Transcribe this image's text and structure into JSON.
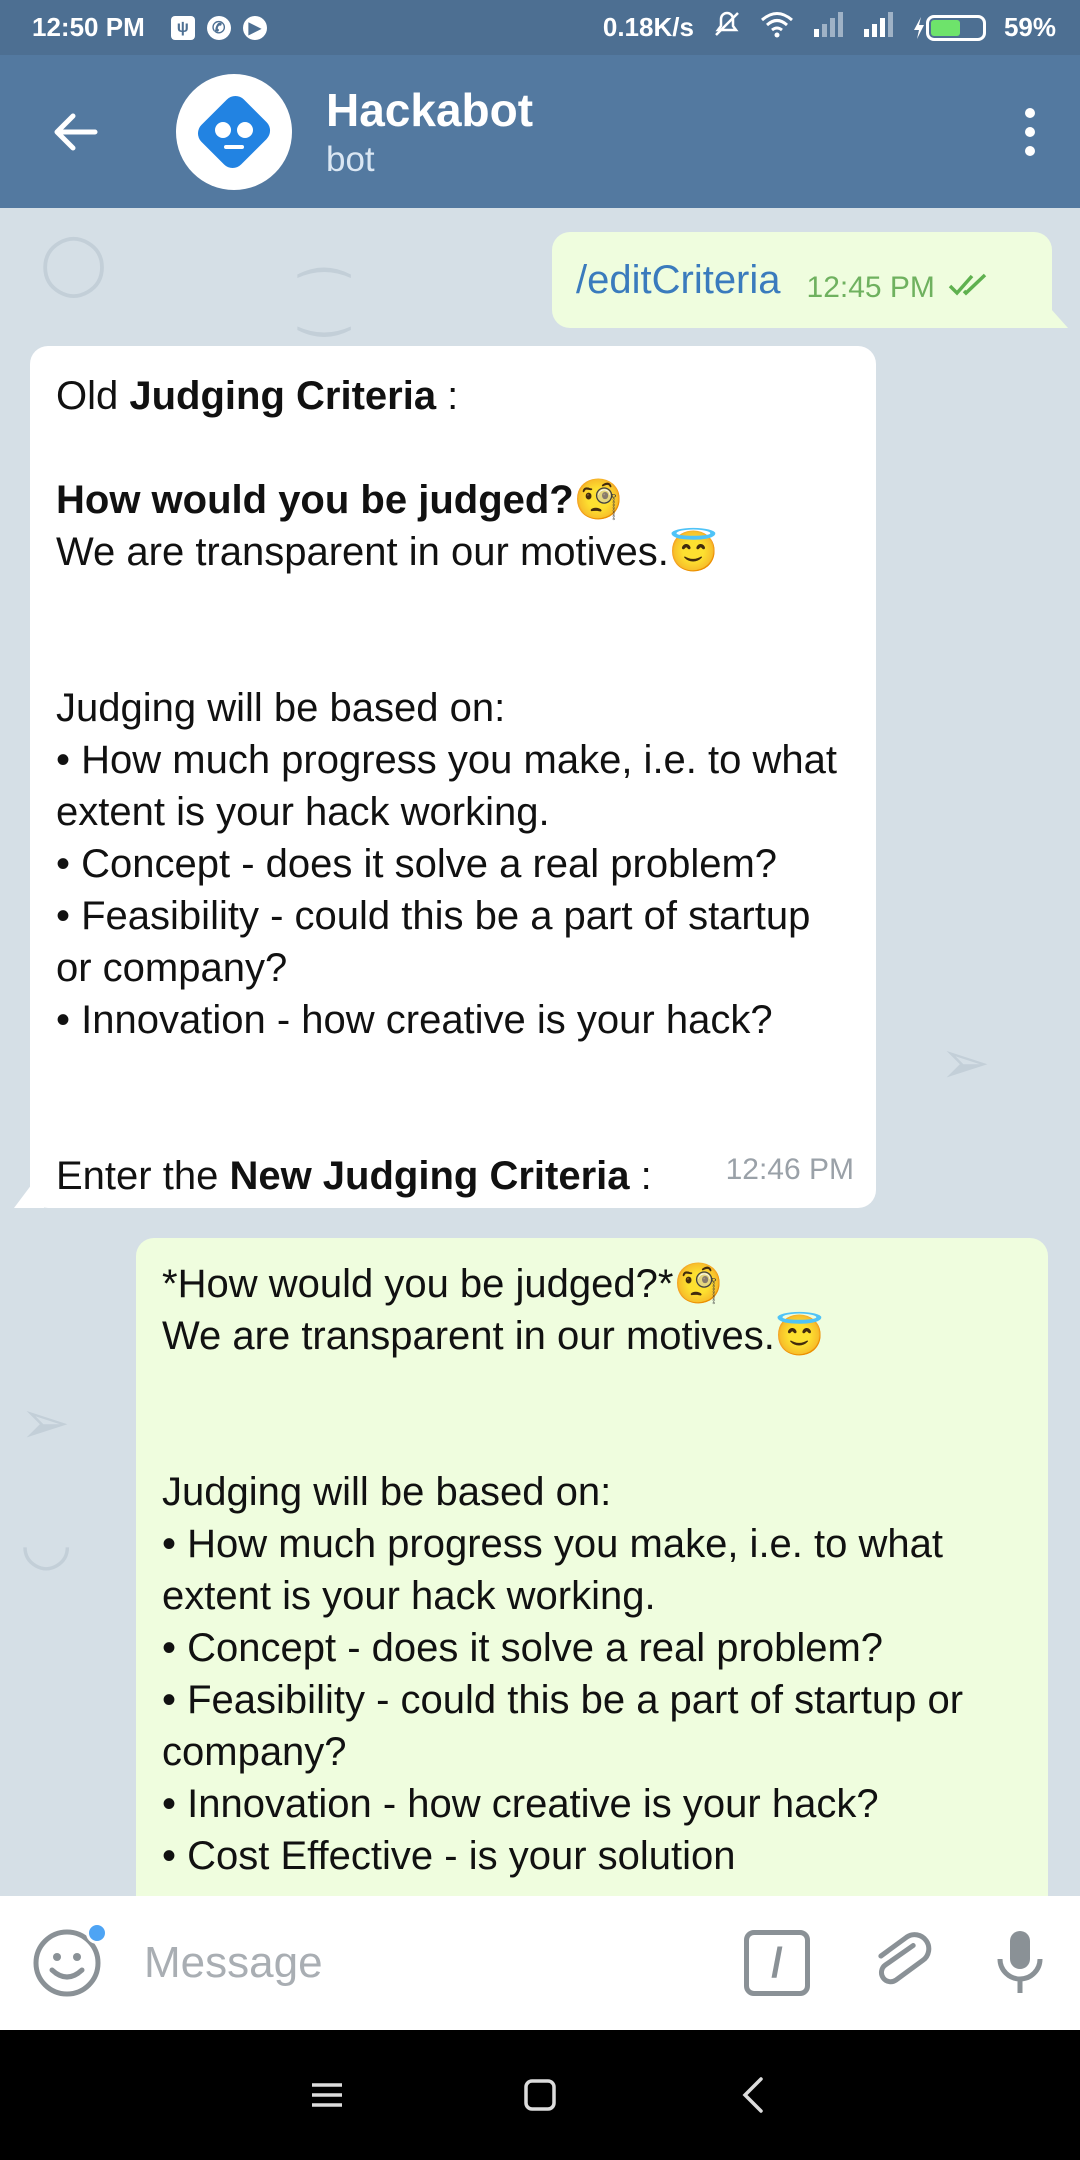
{
  "status_bar": {
    "time": "12:50 PM",
    "network_speed": "0.18K/s",
    "battery_percent": "59%",
    "battery_level": 0.59
  },
  "header": {
    "title": "Hackabot",
    "subtitle": "bot"
  },
  "messages": {
    "m1": {
      "text": "/editCriteria",
      "time": "12:45 PM"
    },
    "m2": {
      "line1_pre": "Old ",
      "line1_bold": "Judging Criteria",
      "line1_post": " :",
      "heading": "How would you be judged?",
      "heading_emoji": "🧐",
      "motto": "We are transparent in our motives.",
      "motto_emoji": "😇",
      "intro": "Judging will be based on:",
      "bullets": [
        "• How much progress you make, i.e. to what extent is your hack working.",
        "• Concept - does it solve a real problem?",
        "• Feasibility - could this be a part of startup or company?",
        "• Innovation - how creative is your hack?"
      ],
      "prompt_pre": "Enter the ",
      "prompt_bold": "New Judging Criteria",
      "prompt_post": " :",
      "time": "12:46 PM"
    },
    "m3": {
      "heading": "*How would you be judged?*",
      "heading_emoji": "🧐",
      "motto": "We are transparent in our motives.",
      "motto_emoji": "😇",
      "intro": "Judging will be based on:",
      "bullets": [
        "• How much progress you make, i.e. to what extent is your hack working.",
        "• Concept - does it solve a real problem?",
        "• Feasibility - could this be a part of startup or company?",
        "• Innovation - how creative is your hack?",
        "• Cost Effective - is your solution"
      ]
    }
  },
  "input": {
    "placeholder": "Message"
  }
}
